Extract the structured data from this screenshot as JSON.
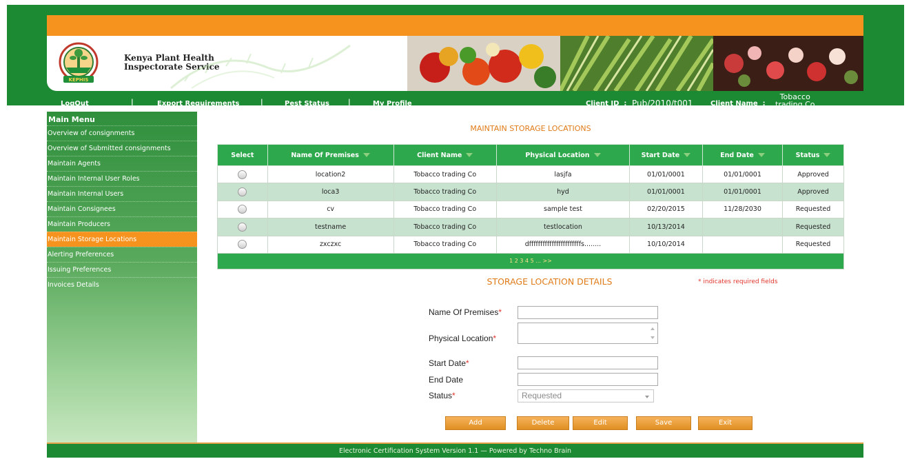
{
  "brand": {
    "line1": "Kenya Plant Health",
    "line2": "Inspectorate Service",
    "logo_text": "KEPHIS"
  },
  "nav": {
    "logout": "LogOut",
    "export": "Export Requirements",
    "pest": "Pest Status",
    "profile": "My Profile",
    "sep": "|",
    "client_id_label": "Client ID",
    "client_id_sep": ":",
    "client_id_value": "Pub/2010/t001",
    "client_name_label": "Client Name",
    "client_name_sep": ":",
    "client_name_line1": "Tobacco",
    "client_name_line2": "trading Co"
  },
  "sidebar": {
    "title": "Main Menu",
    "items": [
      "Overview of consignments",
      "Overview of Submitted consignments",
      "Maintain Agents",
      "Maintain Internal User Roles",
      "Maintain Internal Users",
      "Maintain Consignees",
      "Maintain Producers",
      "Maintain Storage Locations",
      "Alerting Preferences",
      "Issuing Preferences",
      "Invoices Details"
    ],
    "active_index": 7
  },
  "grid": {
    "title": "MAINTAIN STORAGE LOCATIONS",
    "headers": [
      "Select",
      "Name Of Premises",
      "Client Name",
      "Physical Location",
      "Start Date",
      "End Date",
      "Status"
    ],
    "rows": [
      [
        "location2",
        "Tobacco trading Co",
        "lasjfa",
        "01/01/0001",
        "01/01/0001",
        "Approved"
      ],
      [
        "loca3",
        "Tobacco trading Co",
        "hyd",
        "01/01/0001",
        "01/01/0001",
        "Approved"
      ],
      [
        "cv",
        "Tobacco trading Co",
        "sample test",
        "02/20/2015",
        "11/28/2030",
        "Requested"
      ],
      [
        "testname",
        "Tobacco trading Co",
        "testlocation",
        "10/13/2014",
        "",
        "Requested"
      ],
      [
        "zxczxc",
        "Tobacco trading Co",
        "dfffffffffffffffffffffffs........",
        "10/10/2014",
        "",
        "Requested"
      ]
    ],
    "pager": "1 2 3 4 5 ... >>"
  },
  "details": {
    "title": "STORAGE LOCATION DETAILS",
    "required_note": "* indicates required fields",
    "star": "*",
    "labels": {
      "premises": "Name Of Premises",
      "location": "Physical Location",
      "start": "Start Date",
      "end": "End Date",
      "status": "Status"
    },
    "status_value": "Requested"
  },
  "buttons": {
    "add": "Add",
    "delete": "Delete",
    "edit": "Edit",
    "save": "Save",
    "exit": "Exit"
  },
  "footer": "Electronic Certification System Version 1.1 — Powered by Techno Brain",
  "colors": {
    "green": "#1b8a32",
    "orange": "#f6931e",
    "grid_header": "#2ea84c",
    "alt_row": "#c8e2d0"
  }
}
